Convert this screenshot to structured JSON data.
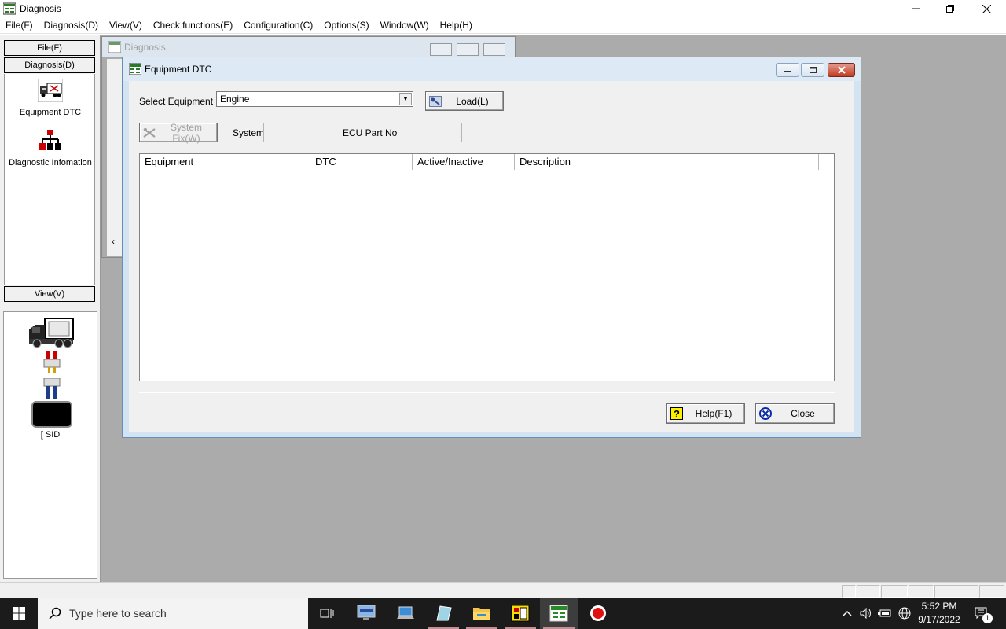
{
  "window": {
    "title": "Diagnosis"
  },
  "menu": [
    "File(F)",
    "Diagnosis(D)",
    "View(V)",
    "Check functions(E)",
    "Configuration(C)",
    "Options(S)",
    "Window(W)",
    "Help(H)"
  ],
  "sidebar": {
    "file_btn": "File(F)",
    "diagnosis_btn": "Diagnosis(D)",
    "view_btn": "View(V)",
    "items": [
      {
        "label": "Equipment DTC",
        "icon": "truck-icon"
      },
      {
        "label": "Diagnostic Infomation",
        "icon": "tree-icon"
      }
    ],
    "status_label": "[ SID"
  },
  "bg_window": {
    "title": "Diagnosis"
  },
  "dialog": {
    "title": "Equipment DTC",
    "select_equipment_label": "Select Equipment",
    "select_equipment_value": "Engine",
    "load_btn": "Load(L)",
    "system_fix_btn": "System Fix(W)",
    "system_label": "System",
    "ecu_label": "ECU Part No.",
    "table": {
      "columns": [
        "Equipment",
        "DTC",
        "Active/Inactive",
        "Description"
      ],
      "rows": []
    },
    "help_btn": "Help(F1)",
    "close_btn": "Close"
  },
  "taskbar": {
    "search_placeholder": "Type here to search",
    "time": "5:52 PM",
    "date": "9/17/2022",
    "notification_count": "1"
  },
  "colors": {
    "workspace": "#ababab",
    "dialog_frame": "#d4e3f1",
    "close_red": "#c23b22",
    "taskbar": "#1b1b1b"
  }
}
